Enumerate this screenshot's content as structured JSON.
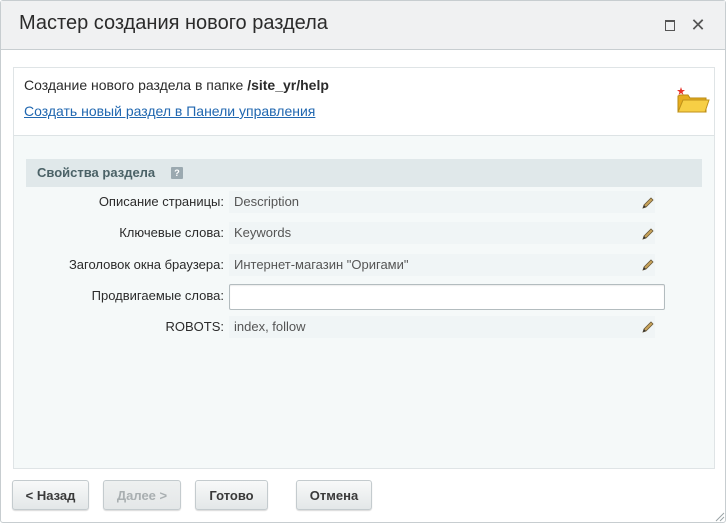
{
  "window": {
    "title": "Мастер создания нового раздела",
    "maximize_icon": "maximize-icon",
    "close_icon": "close-icon",
    "close_glyph": "✕"
  },
  "header": {
    "prefix": "Создание нового раздела в папке ",
    "folder_path": "/site_yr/help",
    "link": "Создать новый раздел в Панели управления",
    "icon": "new-folder-icon"
  },
  "section": {
    "title": "Свойства раздела",
    "help_glyph": "?"
  },
  "fields": {
    "description": {
      "label": "Описание страницы:",
      "value": "Description"
    },
    "keywords": {
      "label": "Ключевые слова:",
      "value": "Keywords"
    },
    "browser_title": {
      "label": "Заголовок окна браузера:",
      "value": "Интернет-магазин \"Оригами\""
    },
    "promoted_words": {
      "label": "Продвигаемые слова:",
      "value": ""
    },
    "robots": {
      "label": "ROBOTS:",
      "value": "index, follow"
    }
  },
  "buttons": {
    "back": "< Назад",
    "next": "Далее >",
    "next_disabled": true,
    "done": "Готово",
    "cancel": "Отмена"
  },
  "colors": {
    "link": "#2067b0",
    "section_bar": "#e0e8ea",
    "field_bg": "#f0f5f6",
    "folder": "#f3c43a"
  }
}
